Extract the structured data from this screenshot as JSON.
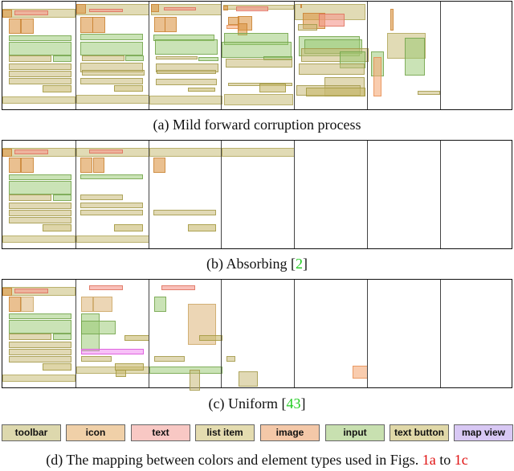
{
  "figure": {
    "rows": [
      {
        "id": "a",
        "caption_prefix": "(a) Mild forward corruption process",
        "caption_ref": "",
        "caption_suffix": "",
        "panel_count": 7
      },
      {
        "id": "b",
        "caption_prefix": "(b) Absorbing [",
        "caption_ref": "2",
        "caption_suffix": "]",
        "panel_count": 7
      },
      {
        "id": "c",
        "caption_prefix": "(c) Uniform [",
        "caption_ref": "43",
        "caption_suffix": "]",
        "panel_count": 7
      }
    ],
    "legend": [
      {
        "label": "toolbar",
        "type": "toolbar",
        "color": "#ddd8ad"
      },
      {
        "label": "icon",
        "type": "icon",
        "color": "#f0d0a8"
      },
      {
        "label": "text",
        "type": "text",
        "color": "#f8c8c4"
      },
      {
        "label": "list item",
        "type": "list_item",
        "color": "#e4dcb0"
      },
      {
        "label": "image",
        "type": "image",
        "color": "#f4c8a8"
      },
      {
        "label": "input",
        "type": "input",
        "color": "#c8e0b0"
      },
      {
        "label": "text button",
        "type": "text_button",
        "color": "#e0d8a8"
      },
      {
        "label": "map view",
        "type": "map_view",
        "color": "#d8c8f4"
      }
    ],
    "final_caption": {
      "prefix": "(d) The mapping between colors and element types used in Figs. ",
      "ref1": "1a",
      "mid": " to ",
      "ref2": "1c"
    },
    "type_styles": {
      "toolbar": {
        "fill": "rgba(200,190,120,0.55)",
        "stroke": "rgba(170,160,80,0.7)"
      },
      "icon": {
        "fill": "rgba(220,150,70,0.6)",
        "stroke": "rgba(200,130,50,0.8)"
      },
      "text": {
        "fill": "rgba(245,150,140,0.6)",
        "stroke": "rgba(220,110,90,0.8)"
      },
      "list_item": {
        "fill": "rgba(200,185,120,0.55)",
        "stroke": "rgba(160,150,70,0.8)"
      },
      "image": {
        "fill": "rgba(245,170,120,0.6)",
        "stroke": "rgba(230,140,80,0.8)"
      },
      "input": {
        "fill": "rgba(150,200,110,0.5)",
        "stroke": "rgba(110,160,70,0.8)"
      },
      "text_button": {
        "fill": "rgba(200,185,110,0.6)",
        "stroke": "rgba(160,150,60,0.8)"
      },
      "map_view": {
        "fill": "rgba(240,130,240,0.5)",
        "stroke": "rgba(220,90,220,0.9)"
      },
      "icon_light": {
        "fill": "rgba(220,180,120,0.55)",
        "stroke": "rgba(200,160,90,0.7)"
      }
    }
  }
}
